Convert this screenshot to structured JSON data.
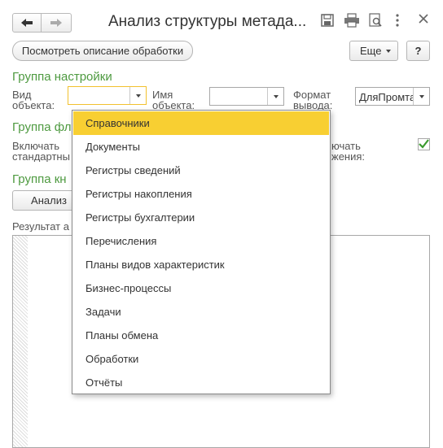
{
  "window": {
    "title": "Анализ структуры метада..."
  },
  "toolbar": {
    "describe_button": "Посмотреть описание обработки",
    "more_button": "Еще",
    "help_button": "?"
  },
  "settings_group": {
    "title": "Группа настройки",
    "object_kind_label": "Вид объекта:",
    "object_name_label": "Имя объекта:",
    "output_format_label": "Формат вывода:",
    "output_format_value": "ДляПромта"
  },
  "flags_group": {
    "title": "Группа фл",
    "include_standard_label": "Включать стандартны",
    "include_right_label": "ючать жения:",
    "checkbox_checked": true
  },
  "buttons_group": {
    "title": "Группа кн",
    "analyze_button": "Анализ"
  },
  "result": {
    "label": "Результат а"
  },
  "dropdown": {
    "items": [
      "Справочники",
      "Документы",
      "Регистры сведений",
      "Регистры накопления",
      "Регистры бухгалтерии",
      "Перечисления",
      "Планы видов характеристик",
      "Бизнес-процессы",
      "Задачи",
      "Планы обмена",
      "Обработки",
      "Отчёты"
    ],
    "selected_index": 0
  },
  "colors": {
    "accent_green": "#4e9a40",
    "selection_yellow": "#f8cf32",
    "focus_border": "#f2c12e"
  }
}
